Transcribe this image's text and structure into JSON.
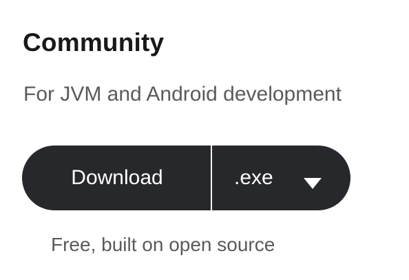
{
  "card": {
    "title": "Community",
    "subtitle": "For JVM and Android development",
    "download": {
      "button_label": "Download",
      "format_selected": ".exe",
      "format_icon": "chevron-down-icon"
    },
    "note": "Free, built on open source"
  },
  "colors": {
    "button_bg": "#27282c",
    "title_text": "#19191c",
    "secondary_text": "#5a5a5e"
  }
}
